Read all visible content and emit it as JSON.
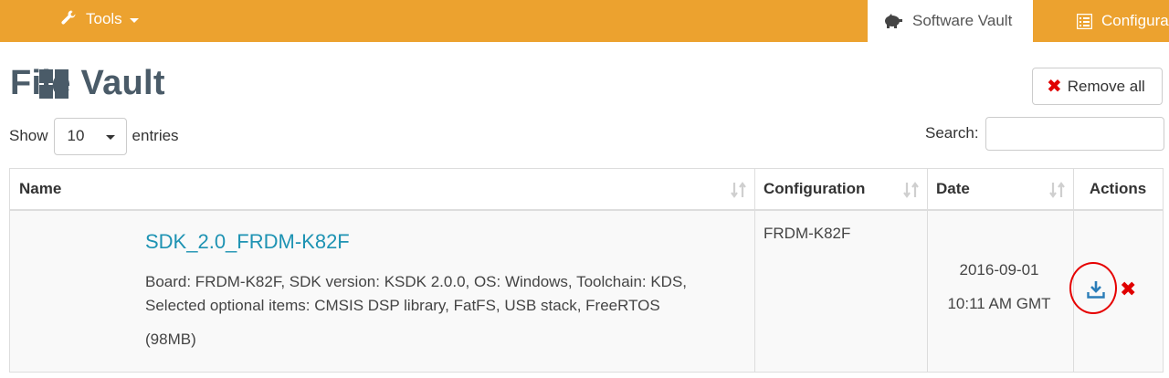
{
  "nav": {
    "tools_label": "Tools",
    "tabs": [
      {
        "label": "Software Vault",
        "active": true
      },
      {
        "label": "Configura",
        "active": false
      }
    ]
  },
  "page": {
    "title": "File Vault",
    "remove_all_label": "Remove all",
    "show_label": "Show",
    "entries_label": "entries",
    "page_size": "10",
    "search_label": "Search:"
  },
  "table": {
    "headers": [
      "Name",
      "Configuration",
      "Date",
      "Actions"
    ],
    "rows": [
      {
        "name": "SDK_2.0_FRDM-K82F",
        "description": "Board: FRDM-K82F, SDK version: KSDK 2.0.0, OS: Windows, Toolchain: KDS, Selected optional items: CMSIS DSP library, FatFS, USB stack, FreeRTOS",
        "size": "(98MB)",
        "os_icon": "windows-icon",
        "configuration": "FRDM-K82F",
        "date": "2016-09-01",
        "time": "10:11 AM GMT"
      }
    ]
  },
  "colors": {
    "nav_bg": "#eca22f",
    "title": "#4a5b68",
    "link": "#1e93b3",
    "danger": "#e00000",
    "download": "#2a7db8"
  }
}
